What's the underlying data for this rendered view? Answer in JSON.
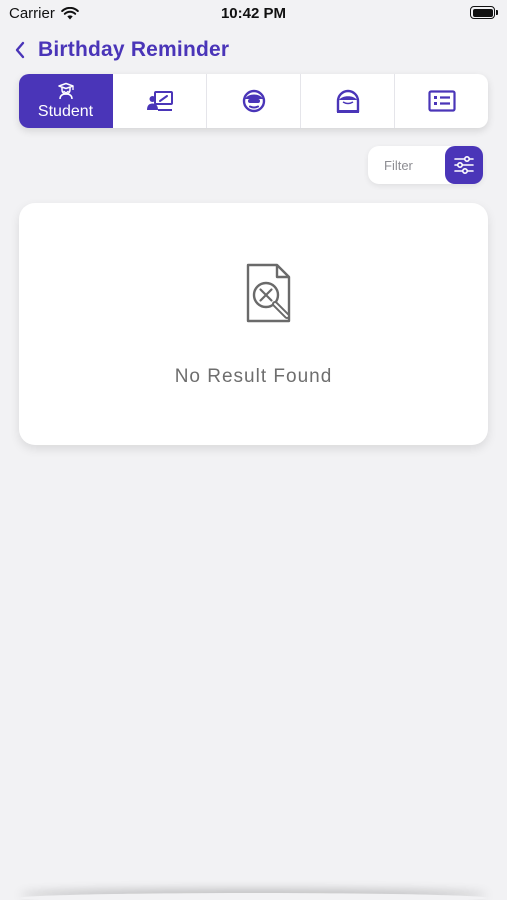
{
  "status_bar": {
    "carrier": "Carrier",
    "time": "10:42 PM"
  },
  "header": {
    "title": "Birthday Reminder",
    "back_icon": "chevron-left-icon"
  },
  "tabs": [
    {
      "label": "Student",
      "icon": "graduate-icon",
      "active": true
    },
    {
      "label": "",
      "icon": "teacher-board-icon",
      "active": false
    },
    {
      "label": "",
      "icon": "staff-icon",
      "active": false
    },
    {
      "label": "",
      "icon": "parent-icon",
      "active": false
    },
    {
      "label": "",
      "icon": "list-card-icon",
      "active": false
    }
  ],
  "filter": {
    "placeholder": "Filter",
    "button_icon": "sliders-icon"
  },
  "results": {
    "empty_message": "No Result Found",
    "empty_icon": "document-search-x-icon"
  },
  "colors": {
    "accent": "#4a35b8",
    "background": "#f2f2f4",
    "card": "#ffffff",
    "muted_text": "#6e6e6e"
  }
}
